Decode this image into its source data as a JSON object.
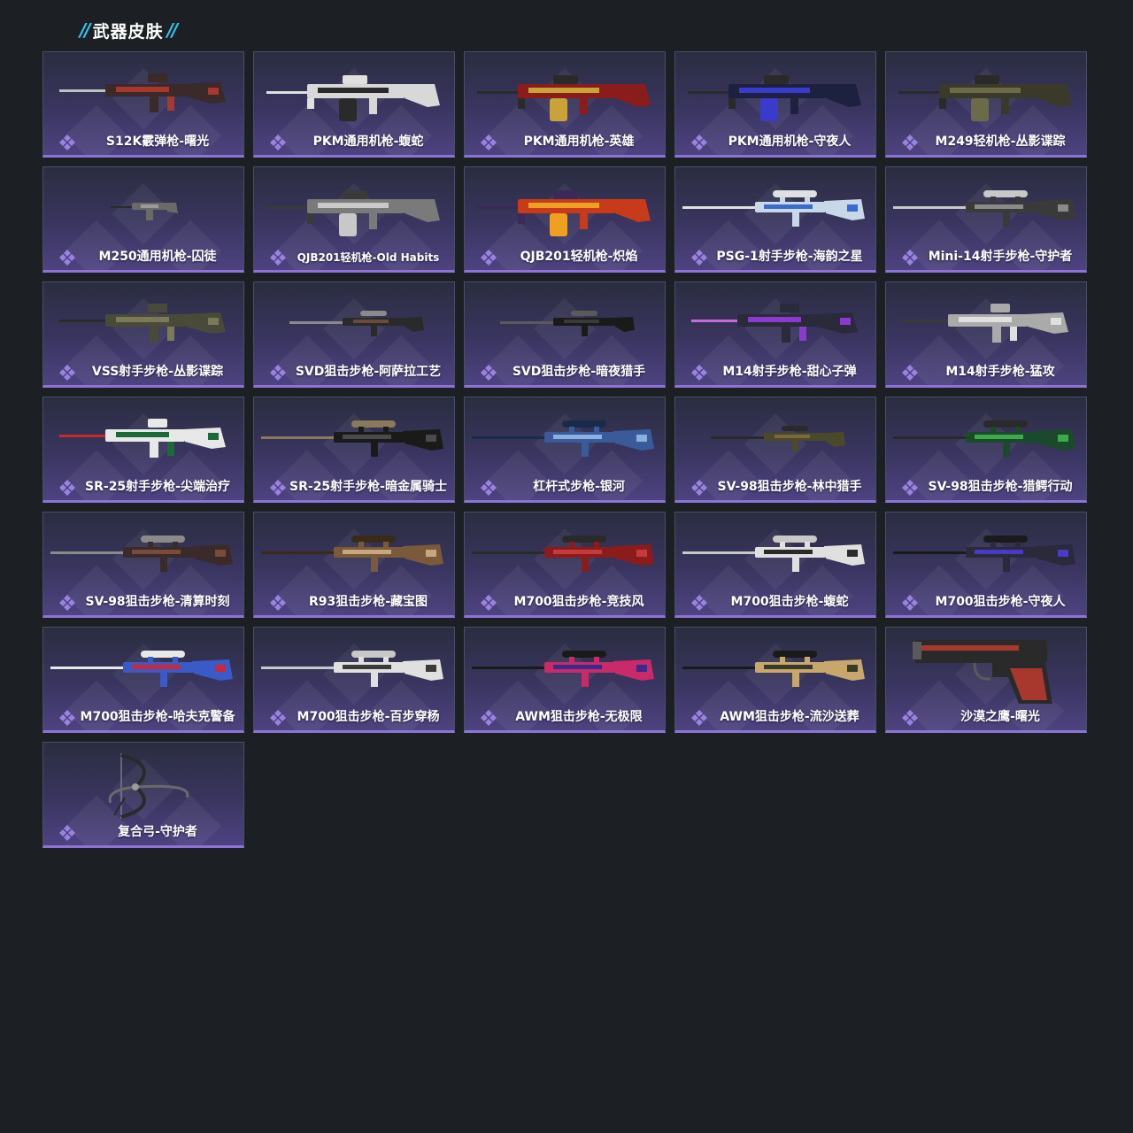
{
  "header": {
    "title": "武器皮肤",
    "accent_color": "#2ec8f0"
  },
  "theme": {
    "page_bg": "#1c2025",
    "card_border_accent": "#8d74d4"
  },
  "skins": [
    {
      "name": "S12K霰弹枪-曙光",
      "weapon": "rifle",
      "colors": [
        "#3a2a2a",
        "#a8372e",
        "#c0c0c0"
      ]
    },
    {
      "name": "PKM通用机枪-蝮蛇",
      "weapon": "mg",
      "colors": [
        "#d8d8d8",
        "#2a2a2a",
        "#e0e0e0"
      ]
    },
    {
      "name": "PKM通用机枪-英雄",
      "weapon": "mg",
      "colors": [
        "#8a1c1c",
        "#c9a23a",
        "#2a2a2a"
      ]
    },
    {
      "name": "PKM通用机枪-守夜人",
      "weapon": "mg",
      "colors": [
        "#1e2040",
        "#3a3acc",
        "#2a2a2a"
      ]
    },
    {
      "name": "M249轻机枪-丛影谍踪",
      "weapon": "mg",
      "colors": [
        "#3b3a2a",
        "#6b6b4a",
        "#2a2a2a"
      ]
    },
    {
      "name": "M250通用机枪-囚徒",
      "weapon": "mini",
      "colors": [
        "#6a6a6a",
        "#9a9a9a",
        "#2a2a2a"
      ]
    },
    {
      "name": "QJB201轻机枪-Old Habits",
      "weapon": "mg",
      "colors": [
        "#7a7a7a",
        "#c8c8c8",
        "#3a3a3a"
      ]
    },
    {
      "name": "QJB201轻机枪-炽焰",
      "weapon": "mg",
      "colors": [
        "#c83a1a",
        "#f0a020",
        "#3a2a5a"
      ]
    },
    {
      "name": "PSG-1射手步枪-海韵之星",
      "weapon": "sniper",
      "colors": [
        "#c8d8e8",
        "#3a6acc",
        "#e0e0e0"
      ]
    },
    {
      "name": "Mini-14射手步枪-守护者",
      "weapon": "sniper",
      "colors": [
        "#3a3a3a",
        "#8a8a8a",
        "#c8c8c8"
      ]
    },
    {
      "name": "VSS射手步枪-丛影谍踪",
      "weapon": "rifle",
      "colors": [
        "#4a4a3a",
        "#7a7a5a",
        "#2a2a2a"
      ]
    },
    {
      "name": "SVD狙击步枪-阿萨拉工艺",
      "weapon": "thin",
      "colors": [
        "#2a2a2a",
        "#6a4a3a",
        "#8a8a8a"
      ]
    },
    {
      "name": "SVD狙击步枪-暗夜猎手",
      "weapon": "thin",
      "colors": [
        "#1a1a1a",
        "#3a3a3a",
        "#5a5a5a"
      ]
    },
    {
      "name": "M14射手步枪-甜心子弹",
      "weapon": "rifle",
      "colors": [
        "#2a2a3a",
        "#8a3acc",
        "#c86ad8"
      ]
    },
    {
      "name": "M14射手步枪-猛攻",
      "weapon": "rifle",
      "colors": [
        "#aaaaaa",
        "#e0e0e0",
        "#3a3a3a"
      ]
    },
    {
      "name": "SR-25射手步枪-尖端治疗",
      "weapon": "rifle",
      "colors": [
        "#e8e8e8",
        "#1a6a3a",
        "#c82a2a"
      ]
    },
    {
      "name": "SR-25射手步枪-暗金属骑士",
      "weapon": "sniper",
      "colors": [
        "#1a1a1a",
        "#4a4a4a",
        "#8a7a5a"
      ]
    },
    {
      "name": "杠杆式步枪-银河",
      "weapon": "sniper",
      "colors": [
        "#3a5a9a",
        "#8ab0e0",
        "#1a2a4a"
      ]
    },
    {
      "name": "SV-98狙击步枪-林中猎手",
      "weapon": "thin",
      "colors": [
        "#4a4a2a",
        "#7a6a3a",
        "#2a2a2a"
      ]
    },
    {
      "name": "SV-98狙击步枪-猎鳄行动",
      "weapon": "sniper",
      "colors": [
        "#1a4a2a",
        "#3aaa4a",
        "#2a2a2a"
      ]
    },
    {
      "name": "SV-98狙击步枪-清算时刻",
      "weapon": "sniper",
      "colors": [
        "#3a2a2a",
        "#7a4a3a",
        "#8a8a8a"
      ]
    },
    {
      "name": "R93狙击步枪-藏宝图",
      "weapon": "sniper",
      "colors": [
        "#7a5a3a",
        "#c8a87a",
        "#3a2a1a"
      ]
    },
    {
      "name": "M700狙击步枪-竞技风",
      "weapon": "sniper",
      "colors": [
        "#8a1c1c",
        "#c83a3a",
        "#2a2a2a"
      ]
    },
    {
      "name": "M700狙击步枪-蝮蛇",
      "weapon": "sniper",
      "colors": [
        "#e0e0e0",
        "#2a2a2a",
        "#c8c8c8"
      ]
    },
    {
      "name": "M700狙击步枪-守夜人",
      "weapon": "sniper",
      "colors": [
        "#2a2a3a",
        "#4a3acc",
        "#1a1a1a"
      ]
    },
    {
      "name": "M700狙击步枪-哈夫克警备",
      "weapon": "sniper",
      "colors": [
        "#3a5ac8",
        "#c82a3a",
        "#e8e8e8"
      ]
    },
    {
      "name": "M700狙击步枪-百步穿杨",
      "weapon": "sniper",
      "colors": [
        "#e0e0e0",
        "#3a3a3a",
        "#c8c8c8"
      ]
    },
    {
      "name": "AWM狙击步枪-无极限",
      "weapon": "sniper",
      "colors": [
        "#c82a6a",
        "#3a2a8a",
        "#1a1a1a"
      ]
    },
    {
      "name": "AWM狙击步枪-流沙送葬",
      "weapon": "sniper",
      "colors": [
        "#c8a86a",
        "#3a3a2a",
        "#1a1a1a"
      ]
    },
    {
      "name": "沙漠之鹰-曙光",
      "weapon": "pistol",
      "colors": [
        "#2a2a2a",
        "#a8372e",
        "#5a5a5a"
      ]
    },
    {
      "name": "复合弓-守护者",
      "weapon": "bow",
      "colors": [
        "#2a2a2a",
        "#6a6a6a",
        "#9a9a9a"
      ]
    }
  ]
}
